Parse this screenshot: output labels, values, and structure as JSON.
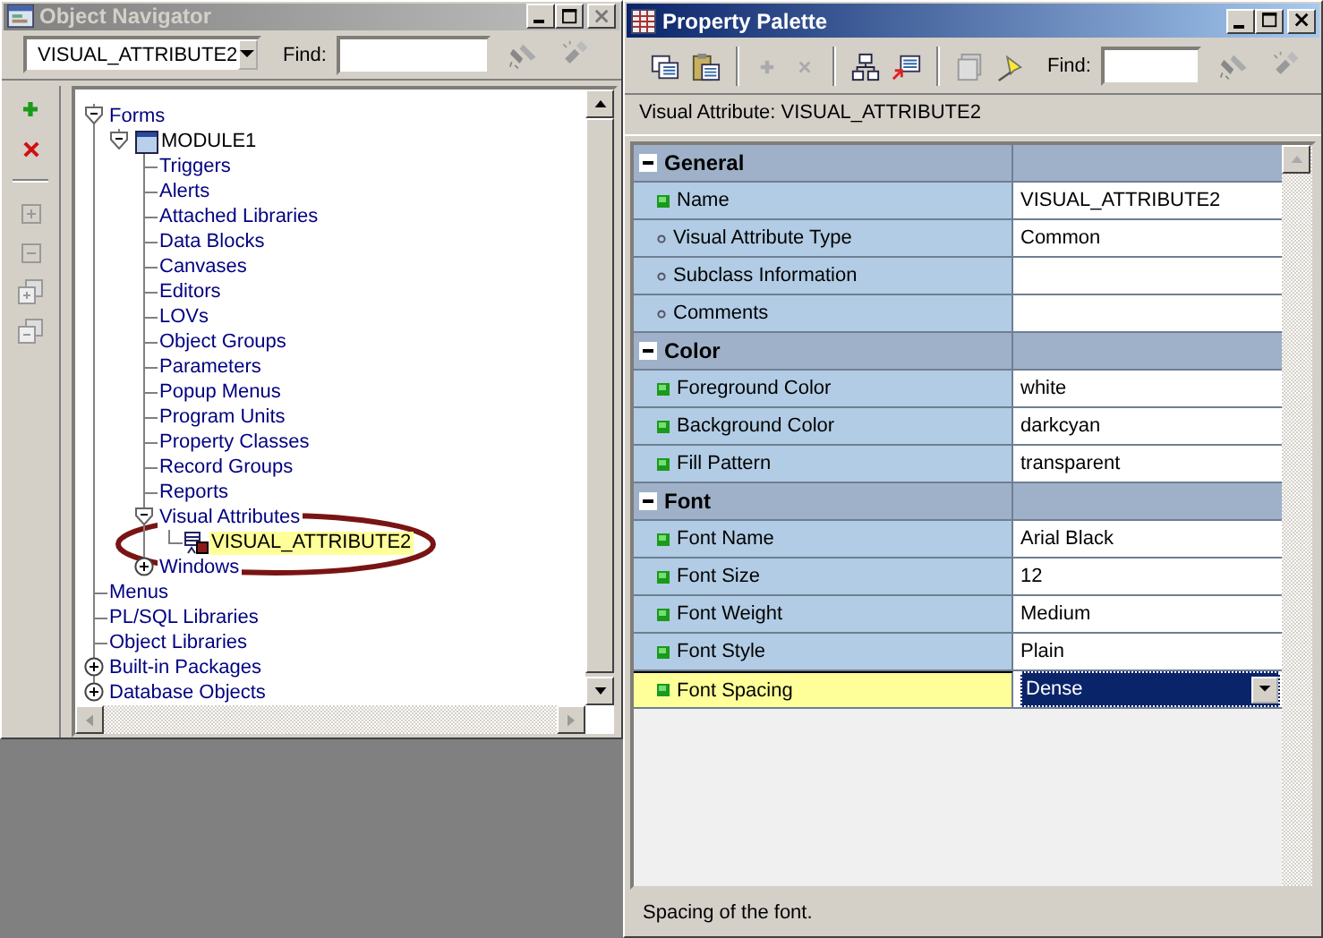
{
  "navigator": {
    "title": "Object Navigator",
    "active": false,
    "combo": {
      "value": "VISUAL_ATTRIBUTE2"
    },
    "find": {
      "label": "Find:"
    },
    "tree": [
      {
        "label": "Forms",
        "kind": "folder",
        "expanded": true,
        "selected": false,
        "children": [
          {
            "label": "MODULE1",
            "kind": "module",
            "expanded": true,
            "selected": false,
            "children": [
              {
                "label": "Triggers",
                "kind": "node",
                "selected": false
              },
              {
                "label": "Alerts",
                "kind": "node",
                "selected": false
              },
              {
                "label": "Attached Libraries",
                "kind": "node",
                "selected": false
              },
              {
                "label": "Data Blocks",
                "kind": "node",
                "selected": false
              },
              {
                "label": "Canvases",
                "kind": "node",
                "selected": false
              },
              {
                "label": "Editors",
                "kind": "node",
                "selected": false
              },
              {
                "label": "LOVs",
                "kind": "node",
                "selected": false
              },
              {
                "label": "Object Groups",
                "kind": "node",
                "selected": false
              },
              {
                "label": "Parameters",
                "kind": "node",
                "selected": false
              },
              {
                "label": "Popup Menus",
                "kind": "node",
                "selected": false
              },
              {
                "label": "Program Units",
                "kind": "node",
                "selected": false
              },
              {
                "label": "Property Classes",
                "kind": "node",
                "selected": false
              },
              {
                "label": "Record Groups",
                "kind": "node",
                "selected": false
              },
              {
                "label": "Reports",
                "kind": "node",
                "selected": false
              },
              {
                "label": "Visual Attributes",
                "kind": "folder",
                "expanded": true,
                "selected": false,
                "children": [
                  {
                    "label": "VISUAL_ATTRIBUTE2",
                    "kind": "attribute",
                    "selected": true
                  }
                ]
              },
              {
                "label": "Windows",
                "kind": "folder",
                "expanded": false,
                "selected": false
              }
            ]
          }
        ]
      },
      {
        "label": "Menus",
        "kind": "node",
        "selected": false
      },
      {
        "label": "PL/SQL Libraries",
        "kind": "node",
        "selected": false
      },
      {
        "label": "Object Libraries",
        "kind": "node",
        "selected": false
      },
      {
        "label": "Built-in Packages",
        "kind": "folder",
        "expanded": false,
        "selected": false
      },
      {
        "label": "Database Objects",
        "kind": "folder",
        "expanded": false,
        "selected": false
      }
    ]
  },
  "palette": {
    "title": "Property Palette",
    "active": true,
    "find": {
      "label": "Find:"
    },
    "heading": "Visual Attribute: VISUAL_ATTRIBUTE2",
    "sections": [
      {
        "title": "General",
        "expanded": true,
        "properties": [
          {
            "name": "Name",
            "value": "VISUAL_ATTRIBUTE2",
            "kind": "set",
            "selected": false
          },
          {
            "name": "Visual Attribute Type",
            "value": "Common",
            "kind": "default",
            "selected": false
          },
          {
            "name": "Subclass Information",
            "kind": "default",
            "selected": false
          },
          {
            "name": "Comments",
            "kind": "default",
            "selected": false
          }
        ]
      },
      {
        "title": "Color",
        "expanded": true,
        "properties": [
          {
            "name": "Foreground Color",
            "value": "white",
            "kind": "set",
            "selected": false
          },
          {
            "name": "Background Color",
            "value": "darkcyan",
            "kind": "set",
            "selected": false
          },
          {
            "name": "Fill Pattern",
            "value": "transparent",
            "kind": "set",
            "selected": false
          }
        ]
      },
      {
        "title": "Font",
        "expanded": true,
        "properties": [
          {
            "name": "Font Name",
            "value": "Arial Black",
            "kind": "set",
            "selected": false
          },
          {
            "name": "Font Size",
            "value": "12",
            "kind": "set",
            "selected": false
          },
          {
            "name": "Font Weight",
            "value": "Medium",
            "kind": "set",
            "selected": false
          },
          {
            "name": "Font Style",
            "value": "Plain",
            "kind": "set",
            "selected": false
          },
          {
            "name": "Font Spacing",
            "value": "Dense",
            "kind": "set",
            "selected": true
          }
        ]
      }
    ],
    "status": "Spacing of the font."
  }
}
